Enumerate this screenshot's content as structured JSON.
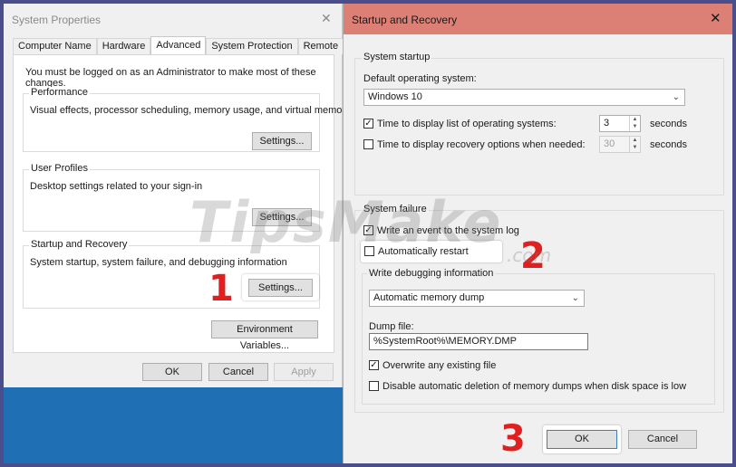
{
  "system_properties": {
    "title": "System Properties",
    "close_glyph": "✕",
    "tabs": [
      {
        "label": "Computer Name"
      },
      {
        "label": "Hardware"
      },
      {
        "label": "Advanced"
      },
      {
        "label": "System Protection"
      },
      {
        "label": "Remote"
      }
    ],
    "active_tab": "Advanced",
    "admin_note": "You must be logged on as an Administrator to make most of these changes.",
    "performance": {
      "legend": "Performance",
      "description": "Visual effects, processor scheduling, memory usage, and virtual memory",
      "button": "Settings..."
    },
    "user_profiles": {
      "legend": "User Profiles",
      "description": "Desktop settings related to your sign-in",
      "button": "Settings..."
    },
    "startup_recovery": {
      "legend": "Startup and Recovery",
      "description": "System startup, system failure, and debugging information",
      "button": "Settings..."
    },
    "env_button": "Environment Variables...",
    "ok": "OK",
    "cancel": "Cancel",
    "apply": "Apply"
  },
  "startup_recovery_dialog": {
    "title": "Startup and Recovery",
    "close_glyph": "✕",
    "system_startup": {
      "title": "System startup",
      "default_os_label": "Default operating system:",
      "default_os_value": "Windows 10",
      "time_list_label": "Time to display list of operating systems:",
      "time_list_checked": true,
      "time_list_value": "3",
      "time_list_unit": "seconds",
      "time_recovery_label": "Time to display recovery options when needed:",
      "time_recovery_checked": false,
      "time_recovery_value": "30",
      "time_recovery_unit": "seconds"
    },
    "system_failure": {
      "title": "System failure",
      "write_event_label": "Write an event to the system log",
      "write_event_checked": true,
      "auto_restart_label": "Automatically restart",
      "auto_restart_checked": false,
      "debug_title": "Write debugging information",
      "debug_type": "Automatic memory dump",
      "dump_file_label": "Dump file:",
      "dump_file_value": "%SystemRoot%\\MEMORY.DMP",
      "overwrite_label": "Overwrite any existing file",
      "overwrite_checked": true,
      "disable_delete_label": "Disable automatic deletion of memory dumps when disk space is low",
      "disable_delete_checked": false
    },
    "ok": "OK",
    "cancel": "Cancel"
  },
  "annotations": {
    "step1": "1",
    "step2": "2",
    "step3": "3"
  },
  "watermark": {
    "main": "TipsMake",
    "sub": ".com"
  },
  "colors": {
    "title_bar_active": "#dc7f74",
    "step_number": "#e02020",
    "desktop": "#1f6fb5",
    "outer_border": "#4a4f8c"
  },
  "icons": {
    "checkbox_checked": "✓",
    "chevron_down": "⌄",
    "spin_up": "▲",
    "spin_down": "▼"
  }
}
